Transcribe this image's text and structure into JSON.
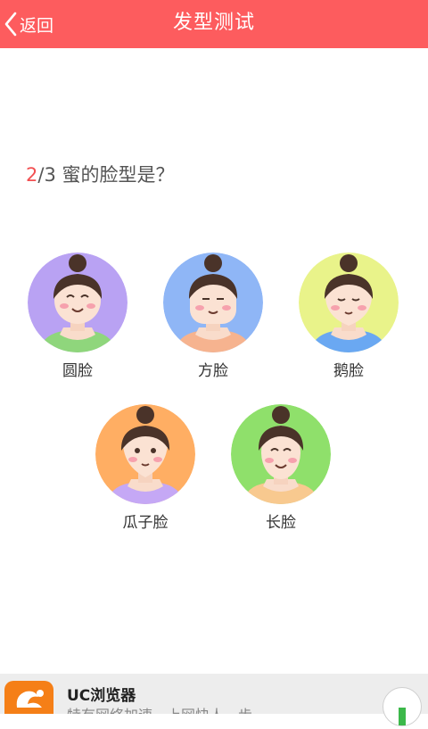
{
  "header": {
    "back_label": "返回",
    "title": "发型测试"
  },
  "question": {
    "current": "2",
    "total_text": "/3 蜜的脸型是？"
  },
  "options": [
    {
      "label": "圆脸",
      "bg": "#b9a2f3",
      "shirt": "#8fd67c"
    },
    {
      "label": "方脸",
      "bg": "#8fb6f6",
      "shirt": "#f6b38f"
    },
    {
      "label": "鹅脸",
      "bg": "#e9f38a",
      "shirt": "#6aa8f2"
    },
    {
      "label": "瓜子脸",
      "bg": "#ffae63",
      "shirt": "#c5a8f5"
    },
    {
      "label": "长脸",
      "bg": "#8fe06b",
      "shirt": "#f8c98f"
    }
  ],
  "ad": {
    "app_name": "UC浏览器",
    "slogan": "特有网络加速，上网快人一步"
  },
  "colors": {
    "header": "#fd5c5e",
    "accent": "#f24f51"
  }
}
